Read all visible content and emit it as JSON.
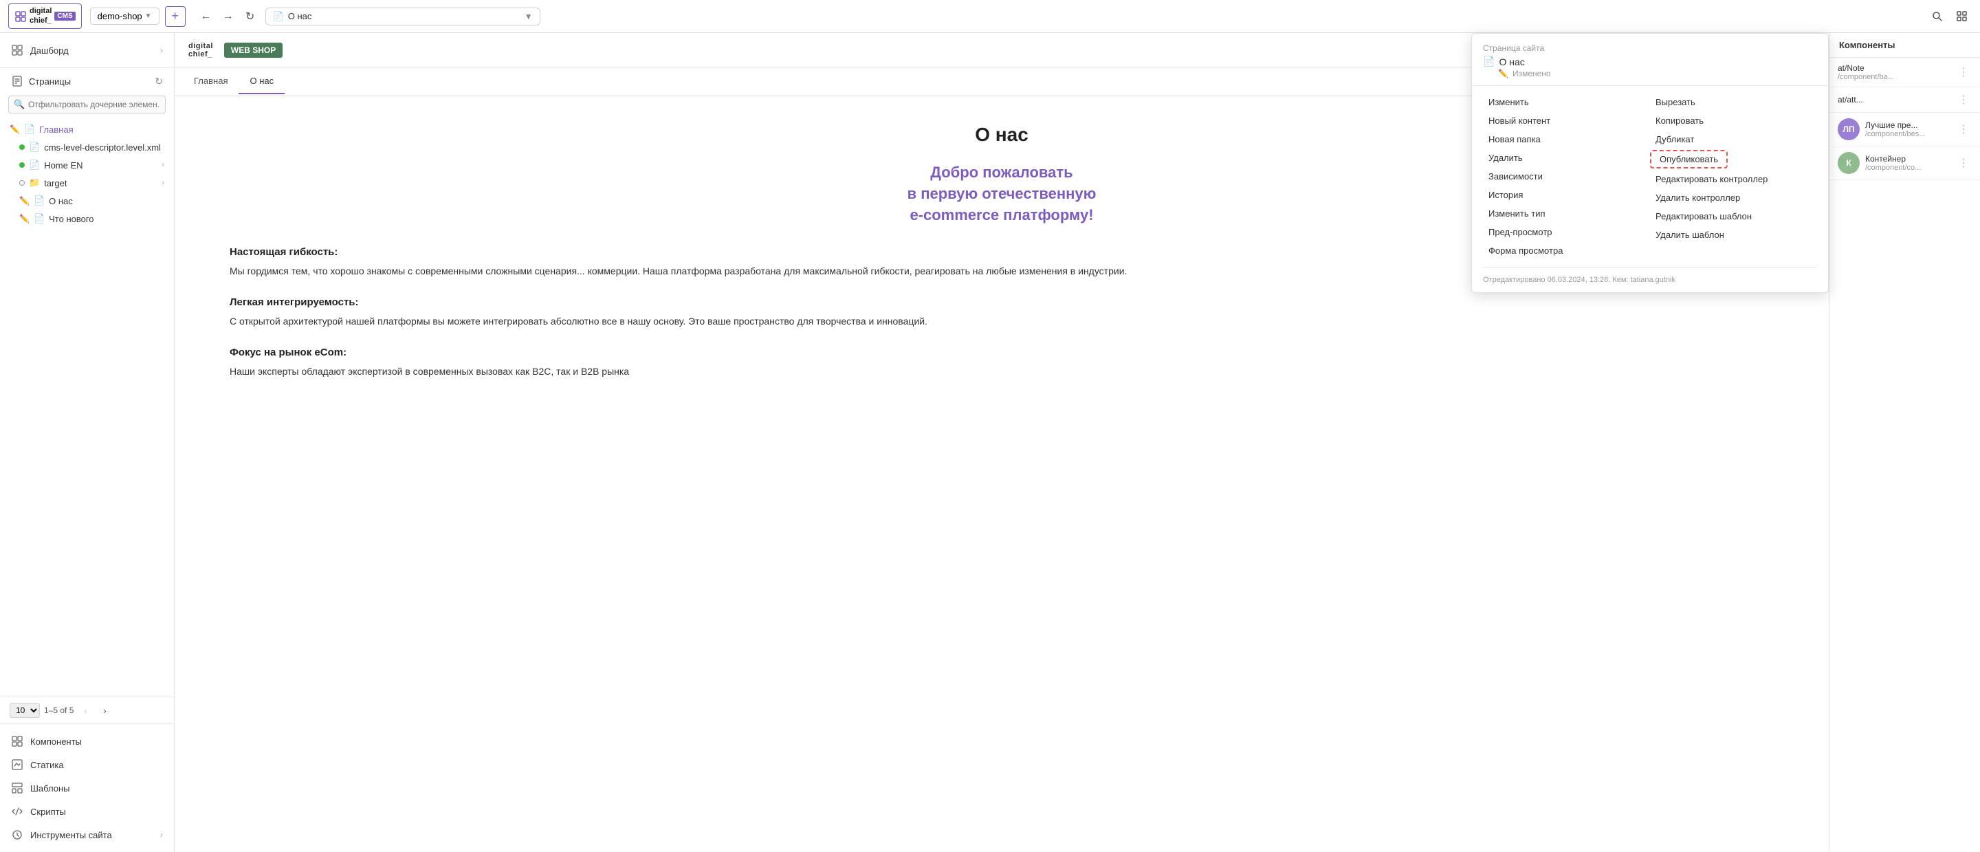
{
  "topbar": {
    "logo_text": "digital\nchief_",
    "cms_label": "CMS",
    "demo_shop": "demo-shop",
    "add_btn": "+",
    "url_text": "О нас",
    "search_icon": "🔍",
    "grid_icon": "⊞"
  },
  "sidebar": {
    "items": [
      {
        "id": "dashboard",
        "label": "Дашборд",
        "has_chevron": true
      },
      {
        "id": "pages",
        "label": "Страницы",
        "has_refresh": true
      }
    ],
    "filter_placeholder": "Отфильтровать дочерние элемен...",
    "tree": [
      {
        "id": "glavnaya",
        "label": "Главная",
        "type": "link",
        "icon": "edit",
        "indent": 0
      },
      {
        "id": "cms-level",
        "label": "cms-level-descriptor.level.xml",
        "type": "dot-green",
        "indent": 1
      },
      {
        "id": "home-en",
        "label": "Home EN",
        "type": "dot-green",
        "indent": 1,
        "has_chevron": true
      },
      {
        "id": "target",
        "label": "target",
        "type": "folder",
        "indent": 1,
        "has_chevron": true
      },
      {
        "id": "o-nas",
        "label": "О нас",
        "type": "edit",
        "indent": 1
      },
      {
        "id": "chto-novogo",
        "label": "Что нового",
        "type": "edit",
        "indent": 1
      }
    ],
    "pagination": {
      "page_size": "10",
      "range": "1–5 of 5",
      "prev_disabled": true,
      "next_disabled": false
    },
    "bottom_items": [
      {
        "id": "components",
        "label": "Компоненты"
      },
      {
        "id": "statika",
        "label": "Статика"
      },
      {
        "id": "shablony",
        "label": "Шаблоны"
      },
      {
        "id": "skripts",
        "label": "Скрипты"
      },
      {
        "id": "instruments",
        "label": "Инструменты сайта",
        "has_chevron": true
      }
    ]
  },
  "page_tabs": [
    {
      "id": "glavnaya",
      "label": "Главная",
      "active": false
    },
    {
      "id": "o-nas",
      "label": "О нас",
      "active": true
    }
  ],
  "page_content": {
    "title": "О нас",
    "subtitle": "Добро пожаловать\nв первую отечественную\ne-commerce платформу!",
    "sections": [
      {
        "title": "Настоящая гибкость:",
        "text": "Мы гордимся тем, что хорошо знакомы с современными сложными сценария... коммерции. Наша платформа разработана для максимальной гибкости, реагировать на любые изменения в индустрии."
      },
      {
        "title": "Легкая интегрируемость:",
        "text": "С открытой архитектурой нашей платформы вы можете интегрировать абсолютно все в нашу основу. Это ваше пространство для творчества и инноваций."
      },
      {
        "title": "Фокус на рынок eCom:",
        "text": "Наши эксперты обладают экспертизой в современных вызовах как В2С, так и В2В рынка"
      }
    ]
  },
  "right_panel": {
    "header": "Компоненты",
    "items": [
      {
        "id": "item1",
        "avatar_color": "#e8c97a",
        "avatar_letter": "",
        "name": "at/Note",
        "path": "/component/ba...",
        "show_avatar": false
      },
      {
        "id": "item2",
        "avatar_color": "#e8c97a",
        "avatar_letter": "",
        "name": "at/att...",
        "path": "",
        "show_avatar": false
      },
      {
        "id": "item3",
        "avatar_color": "#9b7ed6",
        "avatar_letter": "ЛП",
        "name": "Лучшие пре...",
        "path": "/component/bes..."
      },
      {
        "id": "item4",
        "avatar_color": "#8fbb8f",
        "avatar_letter": "К",
        "name": "Контейнер",
        "path": "/component/co..."
      }
    ]
  },
  "context_menu": {
    "header_title": "Страница сайта",
    "page_name": "О нас",
    "page_icon": "📄",
    "status": "Изменено",
    "status_icon": "✏️",
    "menu_items_left": [
      "Изменить",
      "Новый контент",
      "Новая папка",
      "Удалить",
      "Зависимости",
      "История",
      "Изменить тип",
      "Пред-просмотр",
      "Форма просмотра"
    ],
    "menu_items_right": [
      "Вырезать",
      "Копировать",
      "Дубликат",
      "Опубликовать",
      "Редактировать контроллер",
      "Удалить контроллер",
      "Редактировать шаблон",
      "Удалить шаблон"
    ],
    "footer": "Отредактировано 06.03.2024, 13:26. Кем: tatiana.gutnik"
  }
}
